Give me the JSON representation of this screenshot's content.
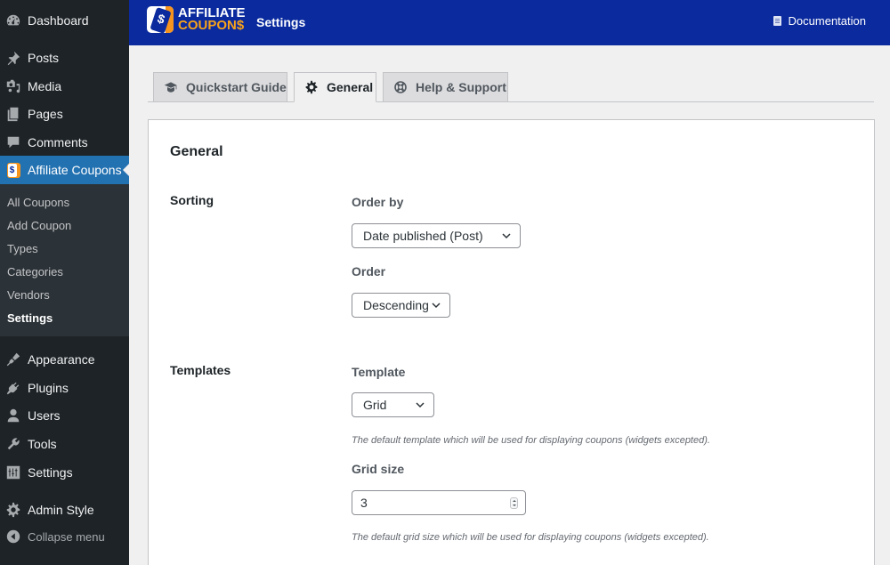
{
  "sidebar": {
    "menu": [
      {
        "label": "Dashboard",
        "icon": "dashboard-icon"
      },
      {
        "label": "Posts",
        "icon": "pin-icon"
      },
      {
        "label": "Media",
        "icon": "media-icon"
      },
      {
        "label": "Pages",
        "icon": "pages-icon"
      },
      {
        "label": "Comments",
        "icon": "comment-icon"
      },
      {
        "label": "Affiliate Coupons",
        "icon": "coupon-icon",
        "active": true
      }
    ],
    "submenu": [
      {
        "label": "All Coupons"
      },
      {
        "label": "Add Coupon"
      },
      {
        "label": "Types"
      },
      {
        "label": "Categories"
      },
      {
        "label": "Vendors"
      },
      {
        "label": "Settings",
        "current": true
      }
    ],
    "menu_lower": [
      {
        "label": "Appearance",
        "icon": "brush-icon"
      },
      {
        "label": "Plugins",
        "icon": "plugin-icon"
      },
      {
        "label": "Users",
        "icon": "user-icon"
      },
      {
        "label": "Tools",
        "icon": "wrench-icon"
      },
      {
        "label": "Settings",
        "icon": "sliders-icon"
      },
      {
        "label": "Admin Style",
        "icon": "gear-icon"
      }
    ],
    "collapse_label": "Collapse menu"
  },
  "header": {
    "logo_line1": "AFFILIATE",
    "logo_line2": "COUPON$",
    "logo_tag_symbol": "$",
    "title": "Settings",
    "documentation_label": "Documentation",
    "brand_color": "#0a2a9e",
    "accent_color": "#f7941d"
  },
  "tabs": [
    {
      "label": "Quickstart Guide",
      "icon": "graduation-cap-icon"
    },
    {
      "label": "General",
      "icon": "gear-icon",
      "active": true
    },
    {
      "label": "Help & Support",
      "icon": "lifebuoy-icon"
    }
  ],
  "general": {
    "section_title": "General",
    "sorting": {
      "label": "Sorting",
      "order_by_label": "Order by",
      "order_by_value": "Date published (Post)",
      "order_label": "Order",
      "order_value": "Descending"
    },
    "templates": {
      "label": "Templates",
      "template_label": "Template",
      "template_value": "Grid",
      "template_desc": "The default template which will be used for displaying coupons (widgets excepted).",
      "grid_size_label": "Grid size",
      "grid_size_value": "3",
      "grid_size_desc": "The default grid size which will be used for displaying coupons (widgets excepted)."
    }
  }
}
